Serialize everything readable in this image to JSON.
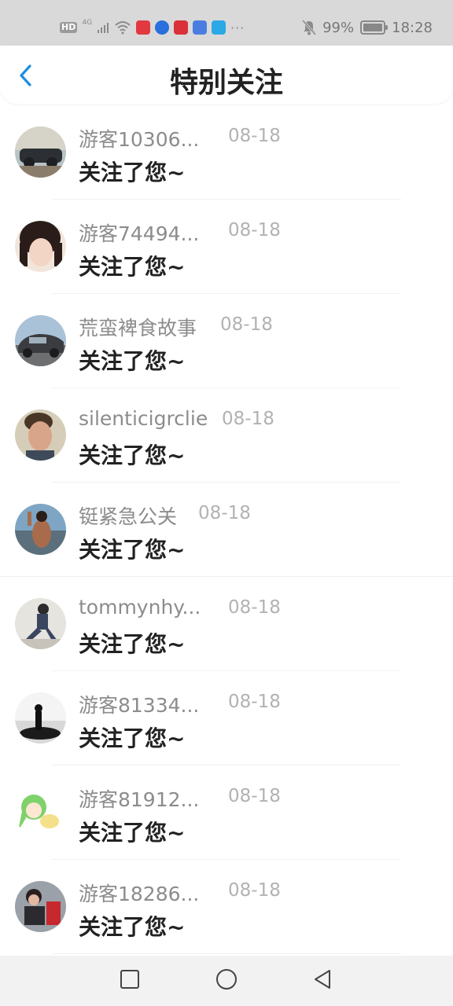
{
  "status_bar": {
    "hd": "HD",
    "network": "4G",
    "battery": "99%",
    "battery_level": 0.99,
    "time": "18:28",
    "more": "···",
    "icons": [
      "hd-icon",
      "signal-icon",
      "wifi-icon",
      "app-red-icon",
      "app-blue-icon",
      "app-red2-icon",
      "music-app-icon",
      "search-app-icon",
      "bell-off-icon",
      "battery-icon"
    ]
  },
  "header": {
    "title": "特别关注",
    "back_icon": "chevron-left-icon",
    "accent": "#1a8fe3"
  },
  "items": [
    {
      "name": "游客10306...",
      "date": "08-18",
      "message": "关注了您~"
    },
    {
      "name": "游客74494...",
      "date": "08-18",
      "message": "关注了您~"
    },
    {
      "name": "荒蛮裨食故事",
      "date": "08-18",
      "message": "关注了您~"
    },
    {
      "name": "silenticigrclie",
      "date": "08-18",
      "message": "关注了您~"
    },
    {
      "name": "铤紧急公关",
      "date": "08-18",
      "message": "关注了您~"
    },
    {
      "name": "tommynhy...",
      "date": "08-18",
      "message": "关注了您~"
    },
    {
      "name": "游客81334...",
      "date": "08-18",
      "message": "关注了您~"
    },
    {
      "name": "游客81912...",
      "date": "08-18",
      "message": "关注了您~"
    },
    {
      "name": "游客18286...",
      "date": "08-18",
      "message": "关注了您~"
    }
  ],
  "nav": {
    "icons": [
      "square-recent-icon",
      "circle-home-icon",
      "triangle-back-icon"
    ]
  }
}
